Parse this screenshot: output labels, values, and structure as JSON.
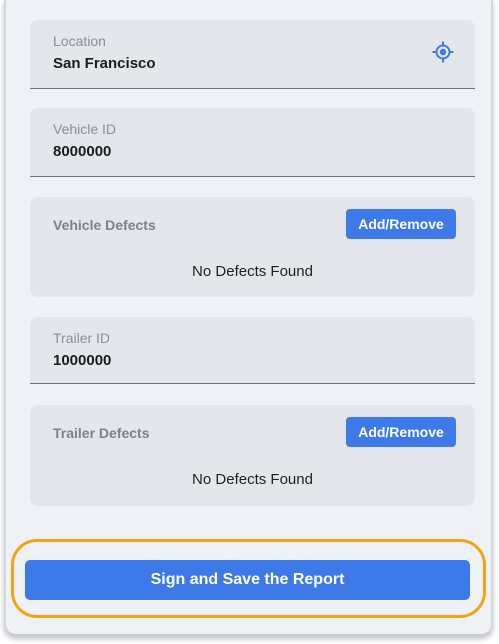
{
  "location": {
    "label": "Location",
    "value": "San Francisco",
    "icon": "gps-target-icon"
  },
  "vehicle_id": {
    "label": "Vehicle ID",
    "value": "8000000"
  },
  "vehicle_defects": {
    "title": "Vehicle Defects",
    "button_label": "Add/Remove",
    "status_text": "No Defects Found"
  },
  "trailer_id": {
    "label": "Trailer ID",
    "value": "1000000"
  },
  "trailer_defects": {
    "title": "Trailer Defects",
    "button_label": "Add/Remove",
    "status_text": "No Defects Found"
  },
  "actions": {
    "save_label": "Sign and Save the Report"
  },
  "colors": {
    "accent": "#3d7ae8",
    "highlight": "#f2a413",
    "card_bg": "#e3e7eb",
    "page_bg": "#eef2f6"
  }
}
